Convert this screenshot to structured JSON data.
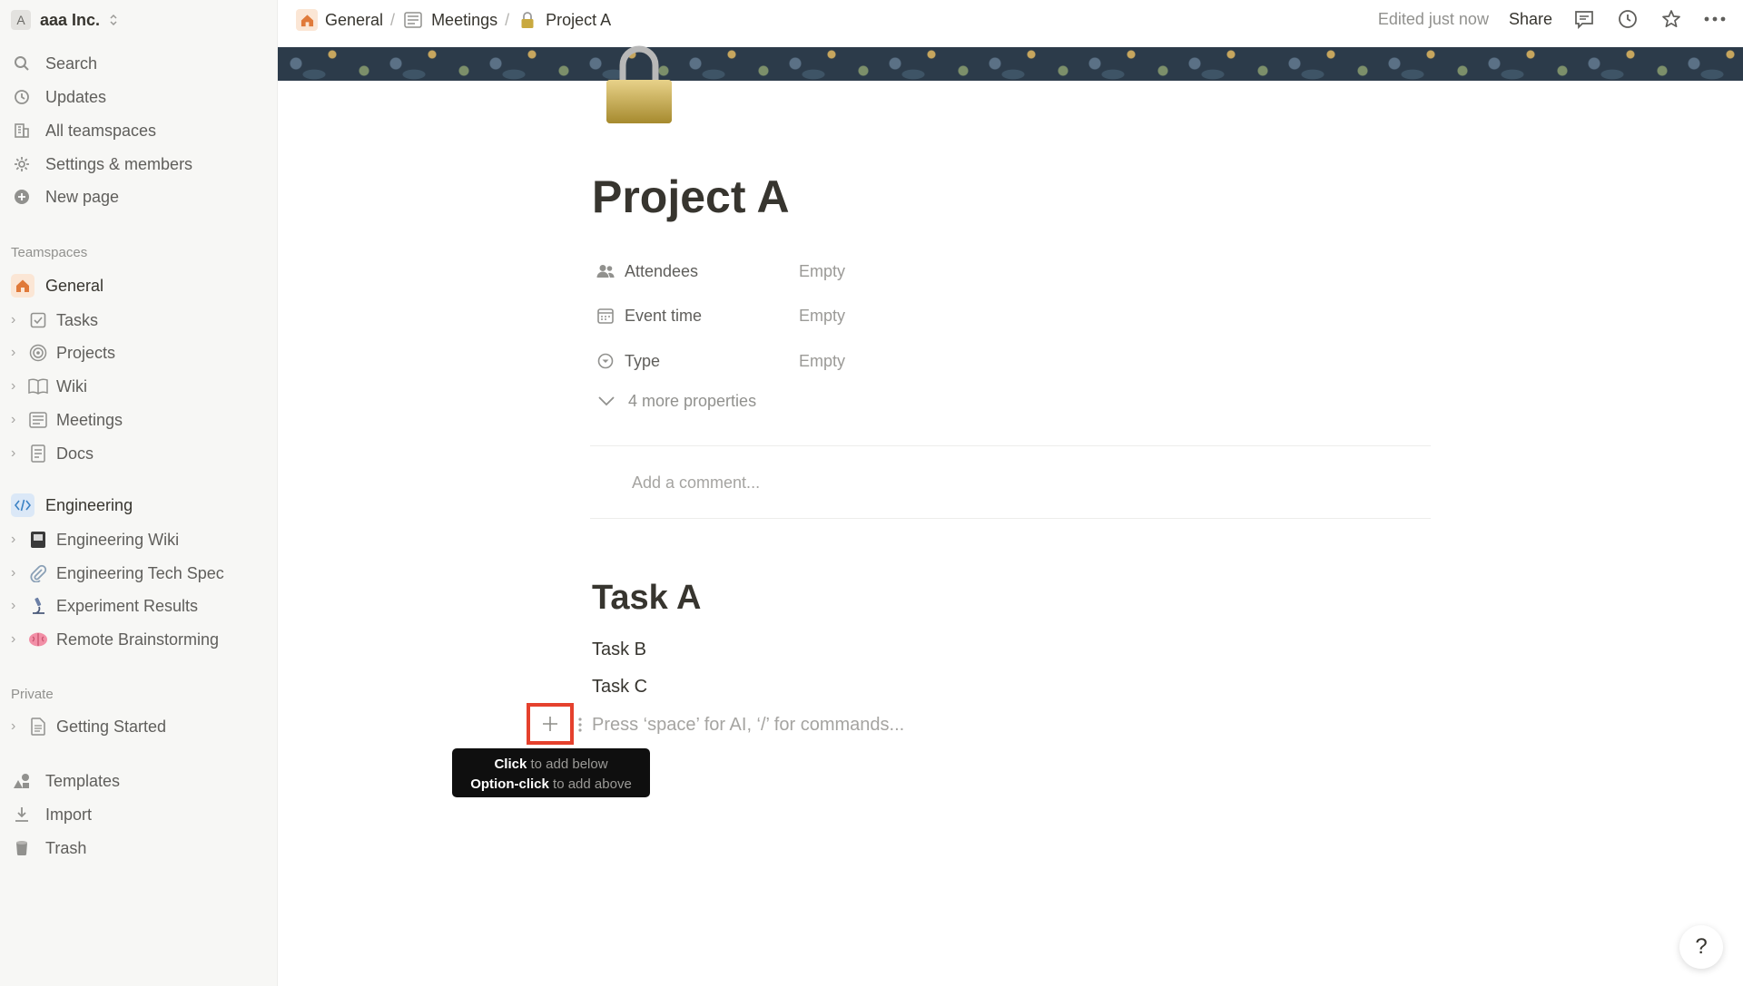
{
  "workspace": {
    "avatar": "A",
    "name": "aaa Inc."
  },
  "nav": [
    {
      "label": "Search",
      "icon": "search-icon"
    },
    {
      "label": "Updates",
      "icon": "clock-icon"
    },
    {
      "label": "All teamspaces",
      "icon": "building-icon"
    },
    {
      "label": "Settings & members",
      "icon": "gear-icon"
    },
    {
      "label": "New page",
      "icon": "plus-circle-icon"
    }
  ],
  "sections": {
    "teamspaces": "Teamspaces",
    "private": "Private"
  },
  "general": {
    "label": "General",
    "children": [
      "Tasks",
      "Projects",
      "Wiki",
      "Meetings",
      "Docs"
    ]
  },
  "engineering": {
    "label": "Engineering",
    "children": [
      "Engineering Wiki",
      "Engineering Tech Spec",
      "Experiment Results",
      "Remote Brainstorming"
    ]
  },
  "private_items": [
    "Getting Started"
  ],
  "bottom_nav": [
    "Templates",
    "Import",
    "Trash"
  ],
  "breadcrumb": [
    "General",
    "Meetings",
    "Project A"
  ],
  "topbar": {
    "edited": "Edited just now",
    "share": "Share"
  },
  "page": {
    "title": "Project A",
    "properties": [
      {
        "name": "Attendees",
        "value": "Empty"
      },
      {
        "name": "Event time",
        "value": "Empty"
      },
      {
        "name": "Type",
        "value": "Empty"
      }
    ],
    "more_properties": "4 more properties",
    "comment_placeholder": "Add a comment...",
    "heading": "Task A",
    "paragraphs": [
      "Task B",
      "Task C"
    ],
    "block_placeholder": "Press ‘space’ for AI, ‘/’ for commands..."
  },
  "tooltip": {
    "line1_em": "Click",
    "line1_rest": " to add below",
    "line2_em": "Option-click",
    "line2_rest": " to add above"
  },
  "help": "?"
}
